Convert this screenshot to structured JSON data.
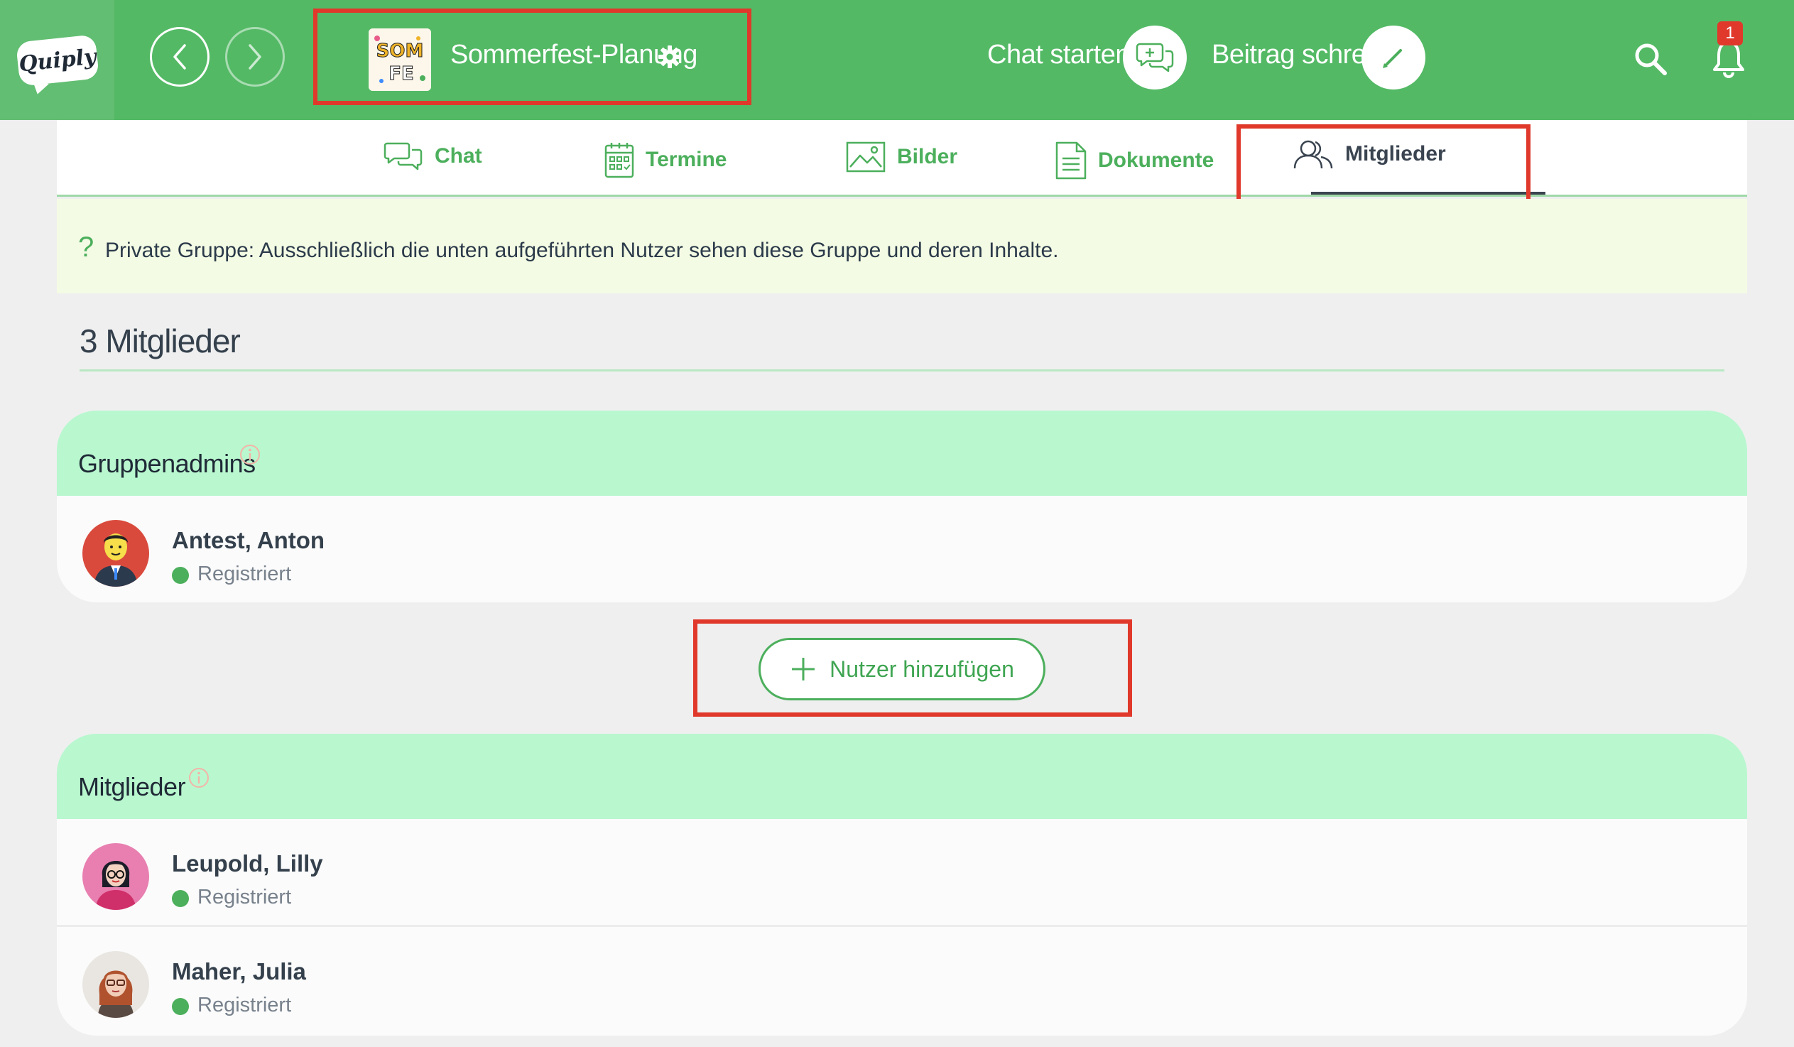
{
  "app": {
    "logo_text": "Quiply"
  },
  "header": {
    "group_thumb_line1": "SOM",
    "group_thumb_line2": "FE",
    "group_title": "Sommerfest-Planung",
    "chat_start_label": "Chat starten",
    "write_post_label": "Beitrag schreiben",
    "notification_count": "1"
  },
  "tabs": [
    {
      "label": "Chat",
      "icon": "chat-icon"
    },
    {
      "label": "Termine",
      "icon": "calendar-icon"
    },
    {
      "label": "Bilder",
      "icon": "image-icon"
    },
    {
      "label": "Dokumente",
      "icon": "document-icon"
    },
    {
      "label": "Mitglieder",
      "icon": "members-icon",
      "active": true
    }
  ],
  "info": {
    "icon": "?",
    "text": "Private Gruppe: Ausschließlich die unten aufgeführten Nutzer sehen diese Gruppe und deren Inhalte."
  },
  "members_count_title": "3 Mitglieder",
  "admins": {
    "title": "Gruppenadmins",
    "members": [
      {
        "name": "Antest, Anton",
        "status": "Registriert"
      }
    ]
  },
  "add_user_label": "Nutzer hinzufügen",
  "members": {
    "title": "Mitglieder",
    "members": [
      {
        "name": "Leupold, Lilly",
        "status": "Registriert"
      },
      {
        "name": "Maher, Julia",
        "status": "Registriert"
      }
    ]
  },
  "colors": {
    "header_green": "#53b965",
    "accent_green": "#4caf5c",
    "card_header": "#b9f7cf",
    "highlight_red": "#e0392b",
    "info_bg": "#f4fbe4"
  }
}
